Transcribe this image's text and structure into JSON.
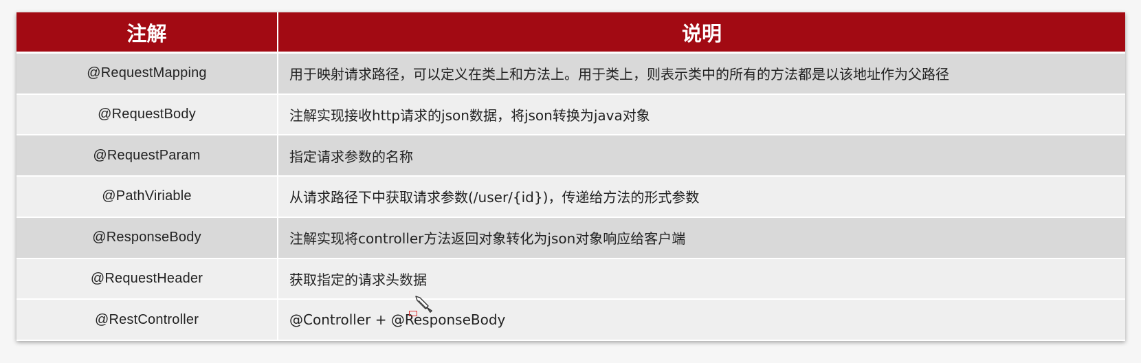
{
  "table": {
    "headers": [
      "注解",
      "说明"
    ],
    "rows": [
      {
        "annotation": "@RequestMapping",
        "description": "用于映射请求路径，可以定义在类上和方法上。用于类上，则表示类中的所有的方法都是以该地址作为父路径"
      },
      {
        "annotation": "@RequestBody",
        "description": "注解实现接收http请求的json数据，将json转换为java对象"
      },
      {
        "annotation": "@RequestParam",
        "description": "指定请求参数的名称"
      },
      {
        "annotation": "@PathViriable",
        "description": "从请求路径下中获取请求参数(/user/{id})，传递给方法的形式参数"
      },
      {
        "annotation": "@ResponseBody",
        "description": "注解实现将controller方法返回对象转化为json对象响应给客户端"
      },
      {
        "annotation": "@RequestHeader",
        "description": "获取指定的请求头数据"
      },
      {
        "annotation": "@RestController",
        "description": "@Controller + @ResponseBody"
      }
    ]
  },
  "colors": {
    "header_bg": "#a20a13",
    "row_odd": "#d9d9d9",
    "row_even": "#efefef"
  },
  "icons": {
    "cursor": "pen-cursor-icon"
  }
}
